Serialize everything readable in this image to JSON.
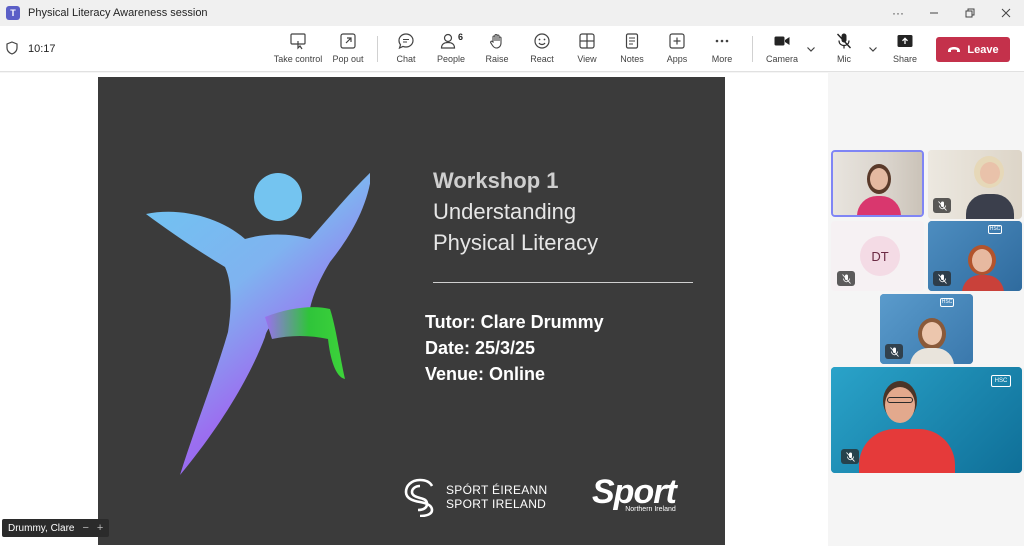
{
  "window": {
    "title": "Physical Literacy Awareness session",
    "app_icon": "teams-icon",
    "controls": [
      "more-icon",
      "minimize-icon",
      "restore-icon",
      "close-icon"
    ]
  },
  "toolbar": {
    "time": "10:17",
    "items": [
      {
        "label": "Take control",
        "icon": "take-control-icon"
      },
      {
        "label": "Pop out",
        "icon": "pop-out-icon"
      },
      {
        "label": "Chat",
        "icon": "chat-icon"
      },
      {
        "label": "People",
        "icon": "people-icon",
        "badge": "6"
      },
      {
        "label": "Raise",
        "icon": "raise-hand-icon"
      },
      {
        "label": "React",
        "icon": "react-icon"
      },
      {
        "label": "View",
        "icon": "view-icon"
      },
      {
        "label": "Notes",
        "icon": "notes-icon"
      },
      {
        "label": "Apps",
        "icon": "apps-icon"
      },
      {
        "label": "More",
        "icon": "more-icon"
      },
      {
        "label": "Camera",
        "icon": "camera-icon"
      },
      {
        "label": "Mic",
        "icon": "mic-off-icon"
      },
      {
        "label": "Share",
        "icon": "share-icon"
      }
    ],
    "leave_label": "Leave",
    "leave_color": "#c4314b"
  },
  "slide": {
    "title_line1": "Workshop 1",
    "title_line2": "Understanding",
    "title_line3": "Physical Literacy",
    "tutor": "Tutor: Clare Drummy",
    "date": "Date: 25/3/25",
    "venue": "Venue: Online",
    "logo1_line1": "SPÓRT ÉIREANN",
    "logo1_line2": "SPORT IRELAND",
    "logo2_main": "Sport",
    "logo2_sub": "Northern Ireland",
    "background": "#3b3b3b"
  },
  "presenter_tag": {
    "name": "Drummy, Clare"
  },
  "participants": [
    {
      "kind": "video",
      "speaking": true,
      "muted": false
    },
    {
      "kind": "video",
      "muted": true
    },
    {
      "kind": "avatar",
      "initials": "DT",
      "muted": true
    },
    {
      "kind": "video",
      "muted": true,
      "overlay": "HSC Public Health Agency"
    },
    {
      "kind": "video",
      "muted": true,
      "overlay": "HSC Public Health Agency"
    },
    {
      "kind": "video",
      "muted": true,
      "overlay": "Public Health Agency"
    }
  ]
}
